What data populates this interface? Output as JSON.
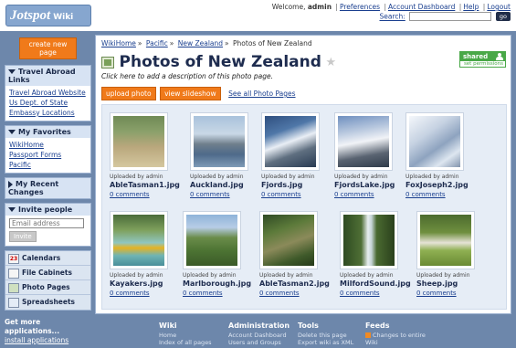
{
  "header": {
    "logo": "Jotspot",
    "logo_sub": "Wiki",
    "welcome": "Welcome,",
    "user": "admin",
    "links": [
      "Preferences",
      "Account Dashboard",
      "Help",
      "Logout"
    ],
    "search_label": "Search:",
    "search_value": "",
    "go_label": "go"
  },
  "sidebar": {
    "create_label": "create new page",
    "travel": {
      "title": "Travel Abroad Links",
      "items": [
        "Travel Abroad Website",
        "Us Dept. of State",
        "Embassy Locations"
      ]
    },
    "favorites": {
      "title": "My Favorites",
      "items": [
        "WikiHome",
        "Passport Forms",
        "Pacific"
      ]
    },
    "recent_title": "My Recent Changes",
    "invite": {
      "title": "Invite people",
      "placeholder": "Email address",
      "button": "Invite"
    },
    "nav": [
      {
        "icon": "calendar-icon",
        "label": "Calendars",
        "badge": "23"
      },
      {
        "icon": "file-cabinet-icon",
        "label": "File Cabinets"
      },
      {
        "icon": "photo-icon",
        "label": "Photo Pages"
      },
      {
        "icon": "spreadsheet-icon",
        "label": "Spreadsheets"
      }
    ],
    "more_apps": "Get more applications...",
    "install_apps": "install applications"
  },
  "main": {
    "breadcrumb": [
      "WikiHome",
      "Pacific",
      "New Zealand",
      "Photos of New Zealand"
    ],
    "title": "Photos of New Zealand",
    "description": "Click here to add a description of this photo page.",
    "shared_label": "shared",
    "shared_sub": "set permissions",
    "upload_label": "upload photo",
    "slideshow_label": "view slideshow",
    "all_pages_label": "See all Photo Pages",
    "photos": [
      {
        "uploaded": "Uploaded by admin",
        "name": "AbleTasman1.jpg",
        "comments": "0 comments"
      },
      {
        "uploaded": "Uploaded by admin",
        "name": "Auckland.jpg",
        "comments": "0 comments"
      },
      {
        "uploaded": "Uploaded by admin",
        "name": "Fjords.jpg",
        "comments": "0 comments"
      },
      {
        "uploaded": "Uploaded by admin",
        "name": "FjordsLake.jpg",
        "comments": "0 comments"
      },
      {
        "uploaded": "Uploaded by admin",
        "name": "FoxJoseph2.jpg",
        "comments": "0 comments"
      },
      {
        "uploaded": "Uploaded by admin",
        "name": "Kayakers.jpg",
        "comments": "0 comments"
      },
      {
        "uploaded": "Uploaded by admin",
        "name": "Marlborough.jpg",
        "comments": "0 comments"
      },
      {
        "uploaded": "Uploaded by admin",
        "name": "AbleTasman2.jpg",
        "comments": "0 comments"
      },
      {
        "uploaded": "Uploaded by admin",
        "name": "MilfordSound.jpg",
        "comments": "0 comments"
      },
      {
        "uploaded": "Uploaded by admin",
        "name": "Sheep.jpg",
        "comments": "0 comments"
      }
    ]
  },
  "footer": {
    "wiki": {
      "title": "Wiki",
      "links": [
        "Home",
        "Index of all pages"
      ]
    },
    "admin": {
      "title": "Administration",
      "links": [
        "Account Dashboard",
        "Users and Groups"
      ]
    },
    "tools": {
      "title": "Tools",
      "links": [
        "Delete this page",
        "Export wiki as XML"
      ]
    },
    "feeds": {
      "title": "Feeds",
      "links": [
        "Changes to entire",
        "Wiki"
      ]
    }
  }
}
